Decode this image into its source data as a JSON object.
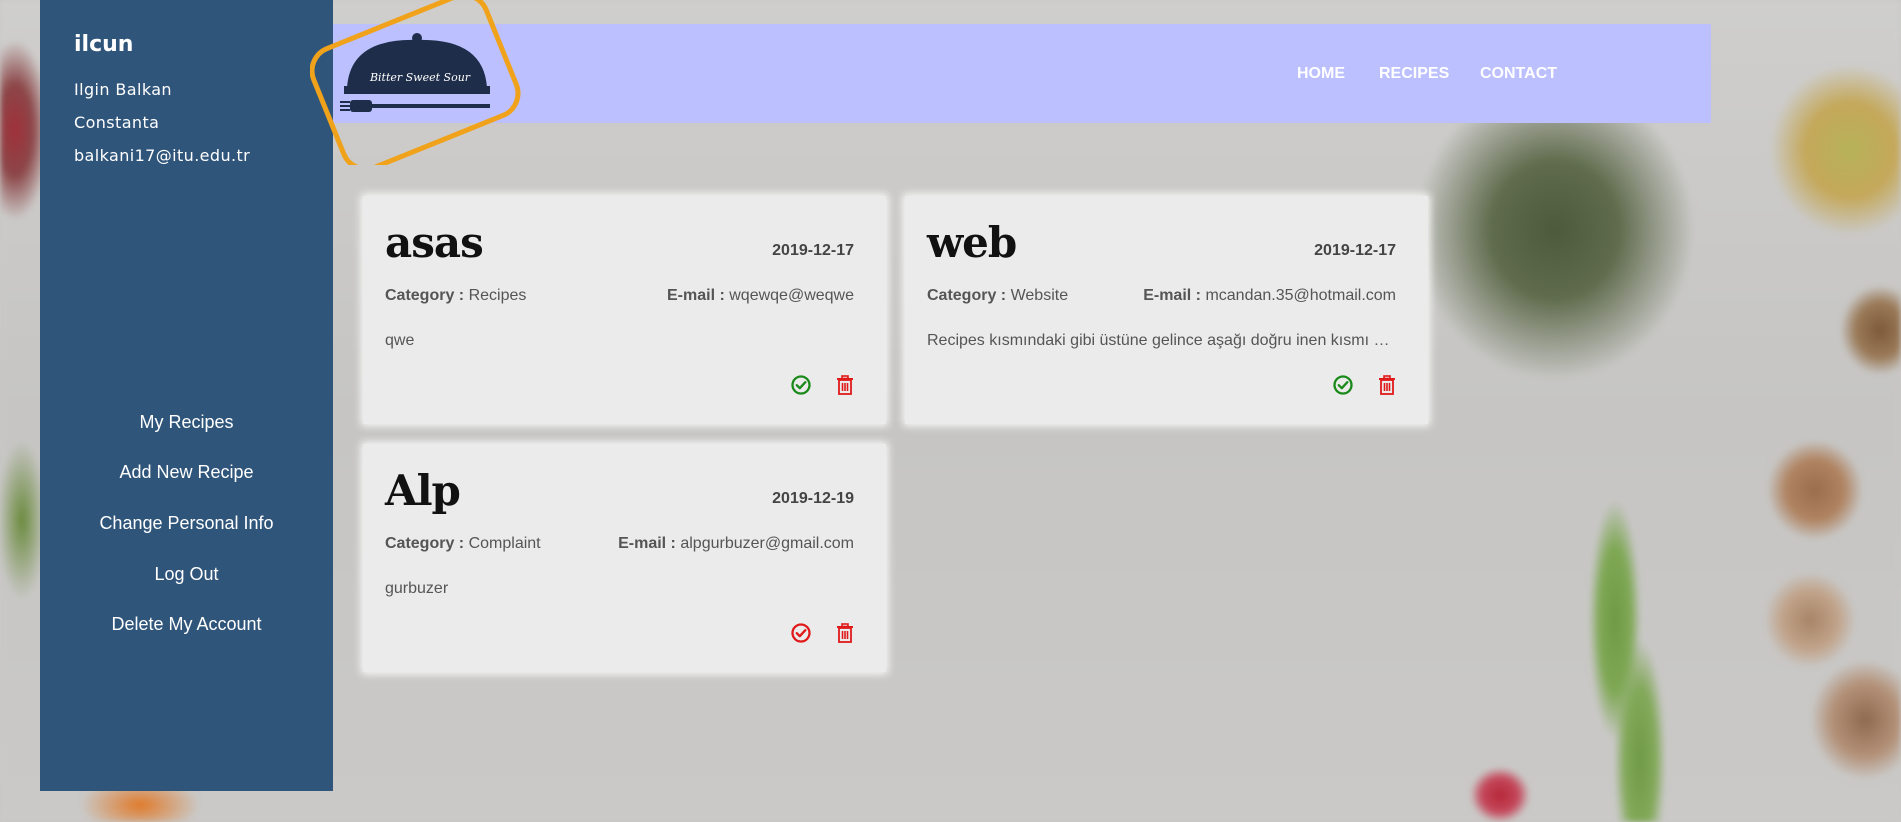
{
  "sidebar": {
    "username": "ilcun",
    "full_name": "Ilgin Balkan",
    "city": "Constanta",
    "email": "balkani17@itu.edu.tr",
    "menu": [
      {
        "label": "My Recipes"
      },
      {
        "label": "Add New Recipe"
      },
      {
        "label": "Change Personal Info"
      },
      {
        "label": "Log Out"
      },
      {
        "label": "Delete My Account"
      }
    ]
  },
  "header": {
    "logo_text": "Bitter Sweet Sour",
    "nav": [
      {
        "label": "HOME"
      },
      {
        "label": "RECIPES"
      },
      {
        "label": "CONTACT"
      }
    ]
  },
  "labels": {
    "category": "Category :",
    "email": "E-mail :"
  },
  "cards": [
    {
      "title": "asas",
      "date": "2019-12-17",
      "category": "Recipes",
      "email": "wqewqe@weqwe",
      "message": "qwe",
      "status_color": "#1a8a1a"
    },
    {
      "title": "web",
      "date": "2019-12-17",
      "category": "Website",
      "email": "mcandan.35@hotmail.com",
      "message": "Recipes kısmındaki gibi üstüne gelince aşağı doğru inen kısmı h…",
      "status_color": "#1a8a1a"
    },
    {
      "title": "Alp",
      "date": "2019-12-19",
      "category": "Complaint",
      "email": "alpgurbuzer@gmail.com",
      "message": "gurbuzer",
      "status_color": "#e01a1a"
    }
  ],
  "colors": {
    "sidebar": "#30557a",
    "header": "#bcc0ff",
    "logo_ring": "#f0a21a",
    "trash": "#e01a1a"
  }
}
